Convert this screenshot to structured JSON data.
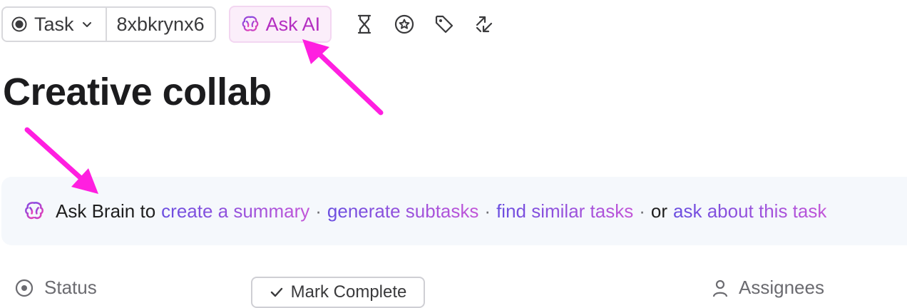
{
  "toolbar": {
    "task_type": "Task",
    "task_id": "8xbkrynx6",
    "ask_ai_label": "Ask AI",
    "icons": [
      "hourglass-icon",
      "badge-star-icon",
      "tag-icon",
      "relationship-arrows-icon"
    ]
  },
  "task": {
    "title": "Creative collab"
  },
  "brain_prompt": {
    "lead": "Ask Brain to",
    "links": [
      "create a summary",
      "generate subtasks",
      "find similar tasks"
    ],
    "separator": "·",
    "or_text": "or",
    "last_link": "ask about this task"
  },
  "fields": {
    "status_label": "Status",
    "mark_complete_label": "Mark Complete",
    "assignees_label": "Assignees"
  },
  "colors": {
    "accent": "#b42ec1",
    "arrow": "#ff1fe0",
    "panel_bg": "#f5f8fc"
  }
}
